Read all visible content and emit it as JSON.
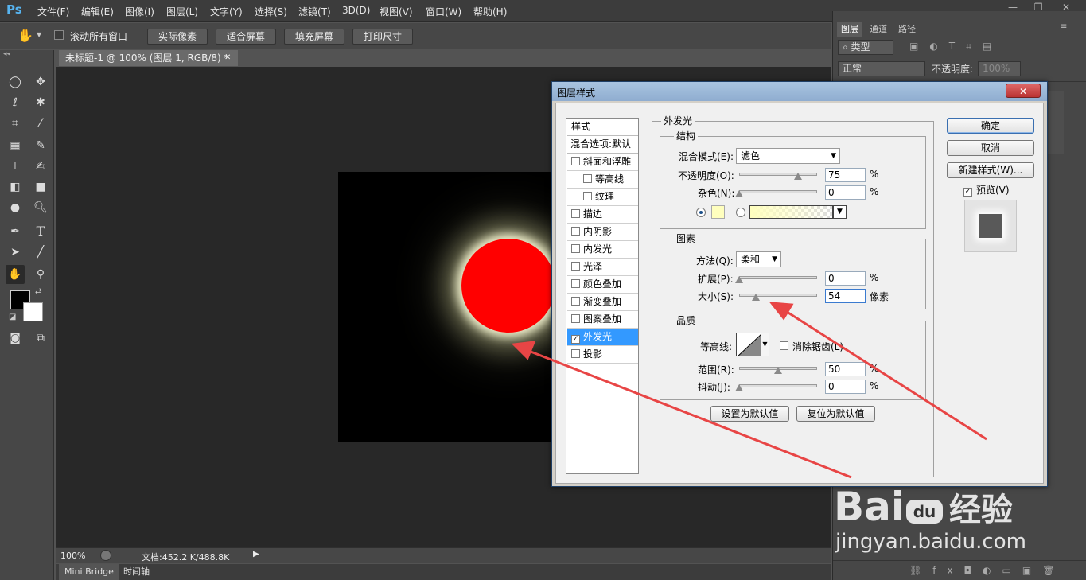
{
  "app": {
    "logo": "Ps",
    "menu": [
      "文件(F)",
      "编辑(E)",
      "图像(I)",
      "图层(L)",
      "文字(Y)",
      "选择(S)",
      "滤镜(T)",
      "3D(D)",
      "视图(V)",
      "窗口(W)",
      "帮助(H)"
    ]
  },
  "options": {
    "scroll_all": "滚动所有窗口",
    "buttons": [
      "实际像素",
      "适合屏幕",
      "填充屏幕",
      "打印尺寸"
    ]
  },
  "document": {
    "tab_title": "未标题-1 @ 100% (图层 1, RGB/8) *",
    "zoom": "100%",
    "doc_info": "文档:452.2 K/488.8K",
    "bottom_tabs": [
      "Mini Bridge",
      "时间轴"
    ]
  },
  "layers_panel": {
    "tabs": [
      "图层",
      "通道",
      "路径"
    ],
    "filter_kind": "类型",
    "blend_mode": "正常",
    "opacity_label": "不透明度:",
    "opacity_value": "100%"
  },
  "dialog": {
    "title": "图层样式",
    "close": "✕",
    "styles_header": "样式",
    "blend_default": "混合选项:默认",
    "style_items": [
      {
        "label": "斜面和浮雕",
        "checked": false,
        "indent": false
      },
      {
        "label": "等高线",
        "checked": false,
        "indent": true
      },
      {
        "label": "纹理",
        "checked": false,
        "indent": true
      },
      {
        "label": "描边",
        "checked": false,
        "indent": false
      },
      {
        "label": "内阴影",
        "checked": false,
        "indent": false
      },
      {
        "label": "内发光",
        "checked": false,
        "indent": false
      },
      {
        "label": "光泽",
        "checked": false,
        "indent": false
      },
      {
        "label": "颜色叠加",
        "checked": false,
        "indent": false
      },
      {
        "label": "渐变叠加",
        "checked": false,
        "indent": false
      },
      {
        "label": "图案叠加",
        "checked": false,
        "indent": false
      },
      {
        "label": "外发光",
        "checked": true,
        "indent": false
      },
      {
        "label": "投影",
        "checked": false,
        "indent": false
      }
    ],
    "section_title": "外发光",
    "structure": {
      "title": "结构",
      "blend_mode_label": "混合模式(E):",
      "blend_mode_value": "滤色",
      "opacity_label": "不透明度(O):",
      "opacity_value": "75",
      "noise_label": "杂色(N):",
      "noise_value": "0",
      "percent": "%",
      "glow_color": "#ffffbe"
    },
    "elements": {
      "title": "图素",
      "technique_label": "方法(Q):",
      "technique_value": "柔和",
      "spread_label": "扩展(P):",
      "spread_value": "0",
      "size_label": "大小(S):",
      "size_value": "54",
      "size_unit": "像素",
      "percent": "%"
    },
    "quality": {
      "title": "品质",
      "contour_label": "等高线:",
      "antialias_label": "消除锯齿(L)",
      "range_label": "范围(R):",
      "range_value": "50",
      "jitter_label": "抖动(J):",
      "jitter_value": "0",
      "percent": "%"
    },
    "make_default": "设置为默认值",
    "reset_default": "复位为默认值",
    "ok": "确定",
    "cancel": "取消",
    "new_style": "新建样式(W)...",
    "preview_label": "预览(V)"
  },
  "sliders": {
    "opacity": 0.75,
    "noise": 0,
    "spread": 0,
    "size": 0.21,
    "range": 0.5,
    "jitter": 0
  },
  "colors": {
    "glow": "#ffffbe",
    "circle": "#ff0000",
    "annotation_arrow": "#e84545",
    "selection": "#3399ff"
  },
  "watermark": {
    "brand": "Bai",
    "paw": "du",
    "product": "经验",
    "url": "jingyan.baidu.com"
  }
}
